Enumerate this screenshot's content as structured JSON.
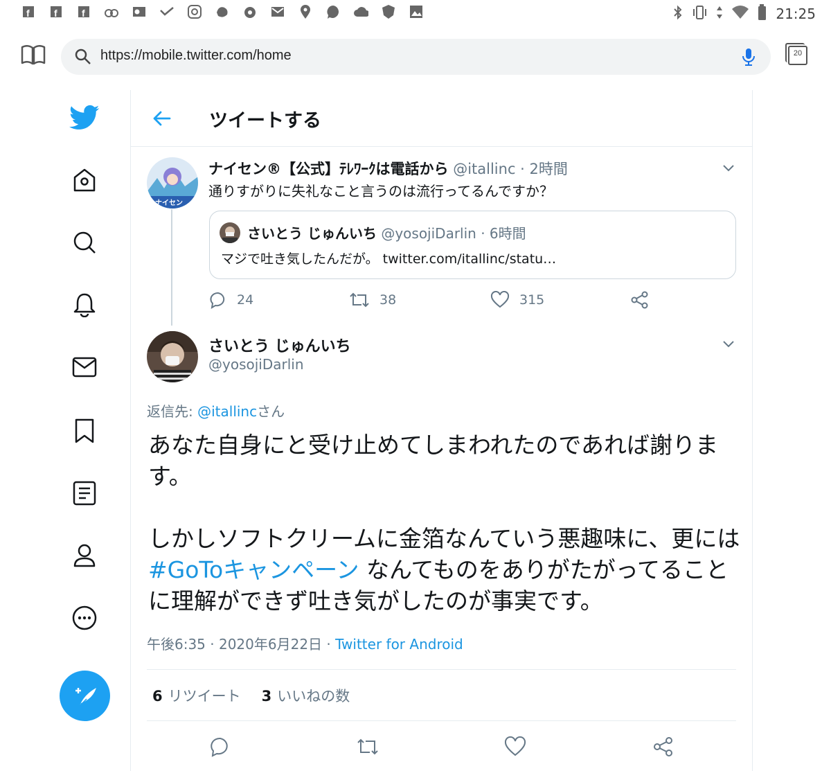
{
  "status_bar": {
    "time": "21:25",
    "notification_icons": [
      "facebook-icon",
      "facebook-icon",
      "facebook-icon",
      "app-icon",
      "outlook-icon",
      "check-icon",
      "instagram-icon",
      "app-icon",
      "app-icon",
      "mail-icon",
      "location-icon",
      "chat-icon",
      "cloud-icon",
      "shield-icon",
      "image-icon"
    ]
  },
  "browser": {
    "url": "https://mobile.twitter.com/home",
    "tab_count": "20"
  },
  "header": {
    "title": "ツイートする"
  },
  "parent_tweet": {
    "name": "ナイセン®【公式】ﾃﾚﾜｰｸは電話から",
    "handle": "@itallinc",
    "time": "· 2時間",
    "text": "通りすがりに失礼なこと言うのは流行ってるんですか？",
    "quote": {
      "name": "さいとう じゅんいち",
      "handle": "@yosojiDarlin",
      "time": "· 6時間",
      "text": "マジで吐き気したんだが。 twitter.com/itallinc/statu…"
    },
    "replies": "24",
    "retweets": "38",
    "likes": "315"
  },
  "main_tweet": {
    "name": "さいとう じゅんいち",
    "handle": "@yosojiDarlin",
    "reply_label": "返信先: ",
    "reply_handle": "@itallinc",
    "reply_suffix": "さん",
    "para1": "あなた自身にと受け止めてしまわれたのであれば謝ります。",
    "para2_before": "しかしソフトクリームに金箔なんていう悪趣味に、更には ",
    "hashtag": "#GoToキャンペーン",
    "para2_after": " なんてものをありがたがってることに理解ができず吐き気がしたのが事実です。",
    "meta_time": "午後6:35 · 2020年6月22日 · ",
    "source": "Twitter for Android",
    "retweet_count": "6",
    "retweet_label": "リツイート",
    "like_count": "3",
    "like_label": "いいねの数"
  },
  "colors": {
    "accent": "#1da1f2",
    "link": "#1b95e0",
    "muted": "#657786",
    "border": "#e6ecf0"
  }
}
